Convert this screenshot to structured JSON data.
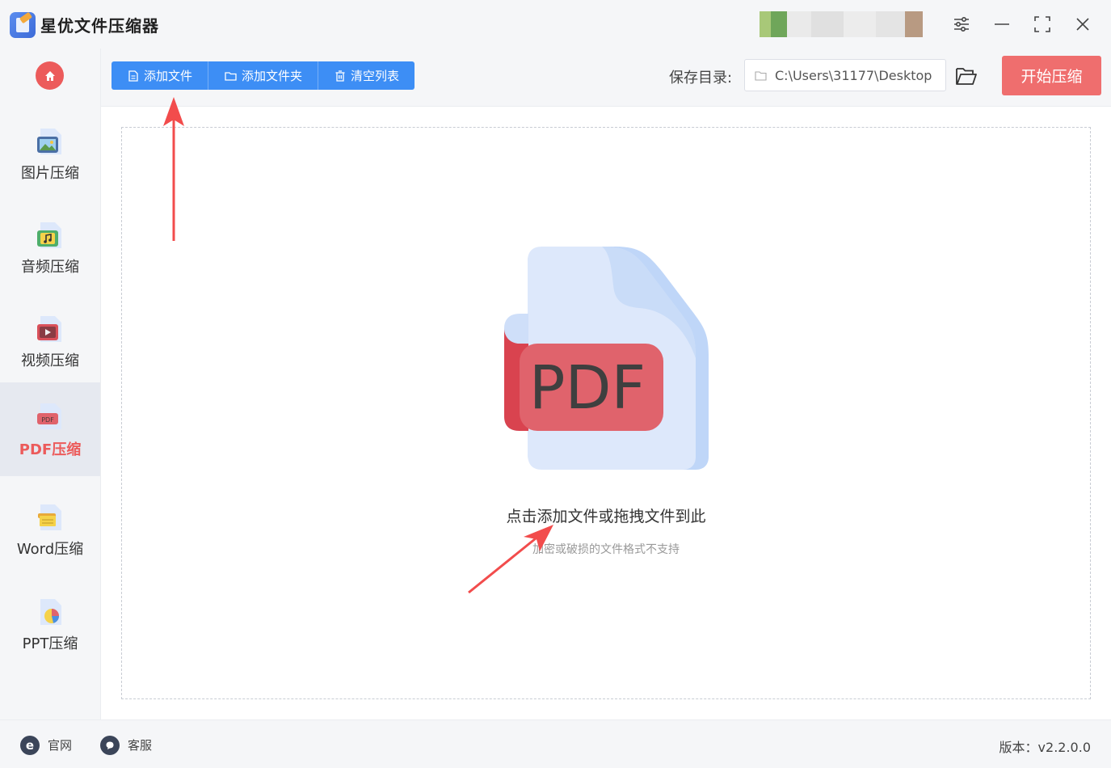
{
  "app": {
    "title": "星优文件压缩器"
  },
  "window_controls": [
    "settings-sliders",
    "minimize",
    "maximize",
    "close"
  ],
  "sidebar": {
    "items": [
      {
        "label": "图片压缩",
        "icon": "image-file-icon",
        "active": false
      },
      {
        "label": "音频压缩",
        "icon": "audio-file-icon",
        "active": false
      },
      {
        "label": "视频压缩",
        "icon": "video-file-icon",
        "active": false
      },
      {
        "label": "PDF压缩",
        "icon": "pdf-file-icon",
        "active": true
      },
      {
        "label": "Word压缩",
        "icon": "word-file-icon",
        "active": false
      },
      {
        "label": "PPT压缩",
        "icon": "ppt-file-icon",
        "active": false
      }
    ]
  },
  "toolbar": {
    "add_file": "添加文件",
    "add_folder": "添加文件夹",
    "clear_list": "清空列表",
    "save_dir_label": "保存目录:",
    "save_dir_path": "C:\\Users\\31177\\Desktop",
    "start_button": "开始压缩"
  },
  "drop_zone": {
    "illustration_text": "PDF",
    "main_text": "点击添加文件或拖拽文件到此",
    "sub_text": "加密或破损的文件格式不支持"
  },
  "footer": {
    "website": "官网",
    "support": "客服",
    "version": "版本：v2.2.0.0"
  },
  "colors": {
    "accent_blue": "#3d8ef5",
    "accent_red": "#ef6e6e",
    "annotation_arrow": "#f24c4c"
  }
}
